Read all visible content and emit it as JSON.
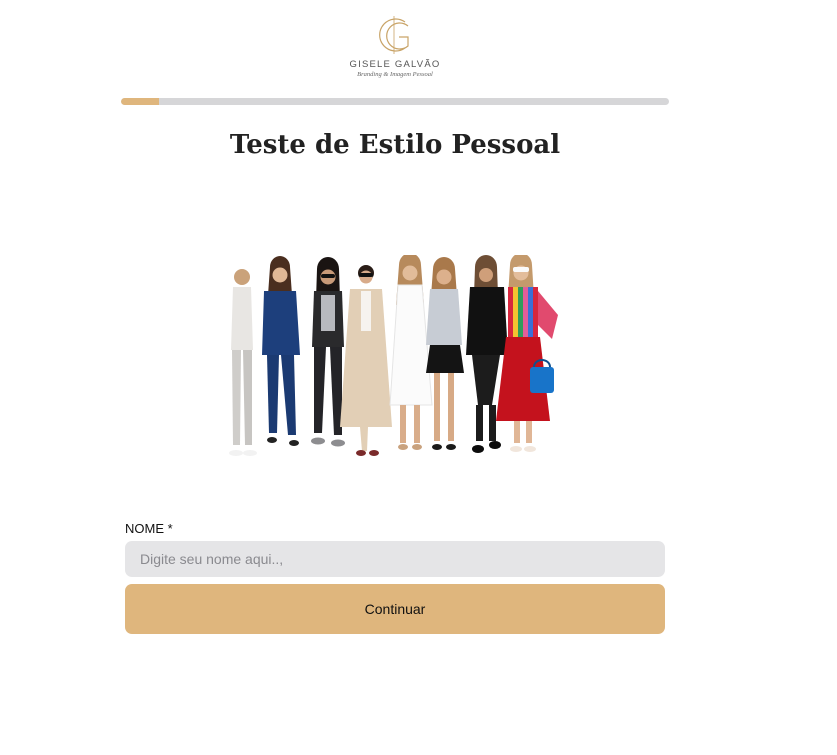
{
  "brand": {
    "logo_letter": "G",
    "name": "GISELE GALVÃO",
    "tagline": "Branding & Imagem Pessoal",
    "accent_color": "#dfb67d"
  },
  "progress": {
    "value_percent": 7
  },
  "page": {
    "title": "Teste de Estilo Pessoal"
  },
  "hero": {
    "icon": "group-of-women-image"
  },
  "form": {
    "name_label": "NOME *",
    "name_placeholder": "Digite seu nome aqui..,",
    "name_value": "",
    "continue_label": "Continuar"
  }
}
